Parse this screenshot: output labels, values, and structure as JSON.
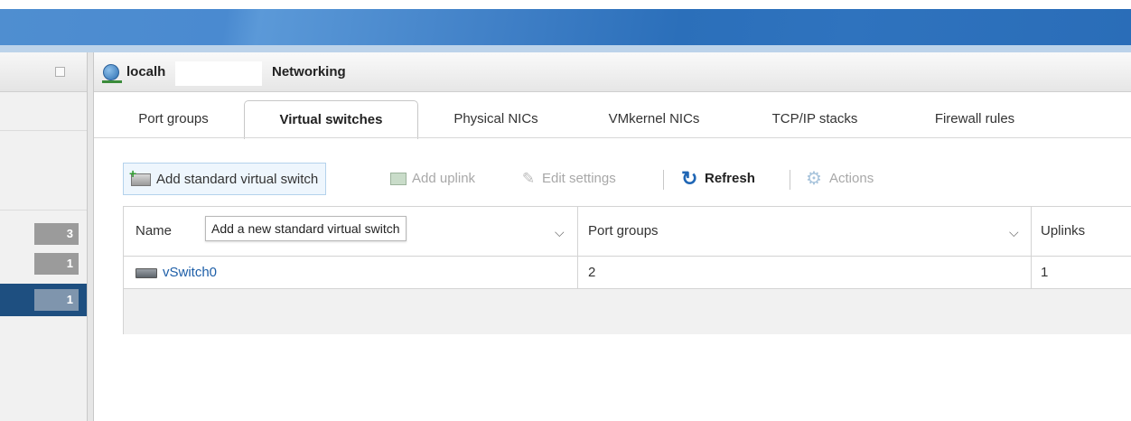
{
  "header": {
    "host_prefix": "localh",
    "section": "Networking"
  },
  "sidebar": {
    "badges": [
      "3",
      "1",
      "1"
    ]
  },
  "tabs": [
    {
      "label": "Port groups"
    },
    {
      "label": "Virtual switches",
      "active": true
    },
    {
      "label": "Physical NICs"
    },
    {
      "label": "VMkernel NICs"
    },
    {
      "label": "TCP/IP stacks"
    },
    {
      "label": "Firewall rules"
    }
  ],
  "toolbar": {
    "add_switch": "Add standard virtual switch",
    "add_uplink": "Add uplink",
    "edit_settings": "Edit settings",
    "refresh": "Refresh",
    "actions": "Actions"
  },
  "tooltip": "Add a new standard virtual switch",
  "grid": {
    "columns": [
      "Name",
      "Port groups",
      "Uplinks"
    ],
    "rows": [
      {
        "name": "vSwitch0",
        "port_groups": "2",
        "uplinks": "1"
      }
    ]
  },
  "colors": {
    "banner": "#2f73be",
    "link": "#1e5fa8",
    "selected_row": "#1e4f80",
    "badge": "#9b9b9b"
  }
}
